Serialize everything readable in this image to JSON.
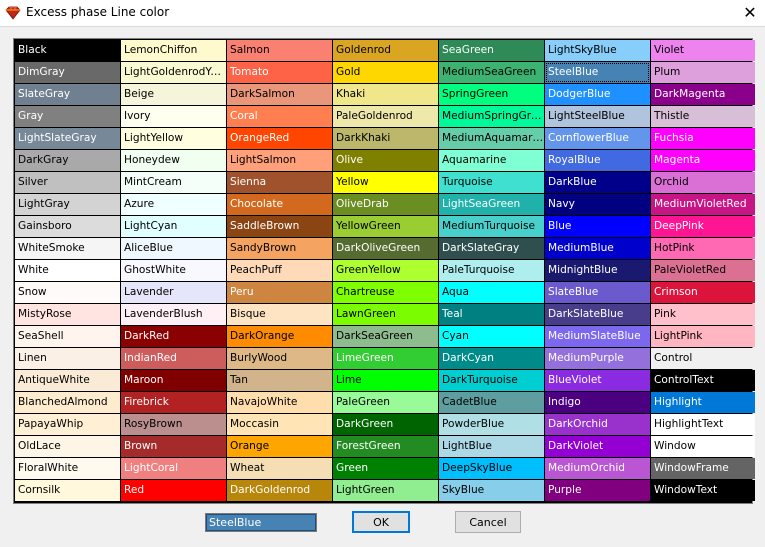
{
  "window": {
    "title": "Excess phase Line color",
    "close_glyph": "✕",
    "icon": "app-diamond-icon"
  },
  "palette": {
    "columns": [
      [
        {
          "name": "Black",
          "bg": "#000000",
          "fg": "#ffffff"
        },
        {
          "name": "DimGray",
          "bg": "#696969",
          "fg": "#ffffff"
        },
        {
          "name": "SlateGray",
          "bg": "#708090",
          "fg": "#ffffff"
        },
        {
          "name": "Gray",
          "bg": "#808080",
          "fg": "#ffffff"
        },
        {
          "name": "LightSlateGray",
          "bg": "#778899",
          "fg": "#ffffff"
        },
        {
          "name": "DarkGray",
          "bg": "#a9a9a9",
          "fg": "#000000"
        },
        {
          "name": "Silver",
          "bg": "#c0c0c0",
          "fg": "#000000"
        },
        {
          "name": "LightGray",
          "bg": "#d3d3d3",
          "fg": "#000000"
        },
        {
          "name": "Gainsboro",
          "bg": "#dcdcdc",
          "fg": "#000000"
        },
        {
          "name": "WhiteSmoke",
          "bg": "#f5f5f5",
          "fg": "#000000"
        },
        {
          "name": "White",
          "bg": "#ffffff",
          "fg": "#000000"
        },
        {
          "name": "Snow",
          "bg": "#fffafa",
          "fg": "#000000"
        },
        {
          "name": "MistyRose",
          "bg": "#ffe4e1",
          "fg": "#000000"
        },
        {
          "name": "SeaShell",
          "bg": "#fff5ee",
          "fg": "#000000"
        },
        {
          "name": "Linen",
          "bg": "#faf0e6",
          "fg": "#000000"
        },
        {
          "name": "AntiqueWhite",
          "bg": "#faebd7",
          "fg": "#000000"
        },
        {
          "name": "BlanchedAlmond",
          "bg": "#ffebcd",
          "fg": "#000000"
        },
        {
          "name": "PapayaWhip",
          "bg": "#ffefd5",
          "fg": "#000000"
        },
        {
          "name": "OldLace",
          "bg": "#fdf5e6",
          "fg": "#000000"
        },
        {
          "name": "FloralWhite",
          "bg": "#fffaf0",
          "fg": "#000000"
        },
        {
          "name": "Cornsilk",
          "bg": "#fff8dc",
          "fg": "#000000"
        }
      ],
      [
        {
          "name": "LemonChiffon",
          "bg": "#fffacd",
          "fg": "#000000"
        },
        {
          "name": "LightGoldenrodYellow",
          "bg": "#fafad2",
          "fg": "#000000"
        },
        {
          "name": "Beige",
          "bg": "#f5f5dc",
          "fg": "#000000"
        },
        {
          "name": "Ivory",
          "bg": "#fffff0",
          "fg": "#000000"
        },
        {
          "name": "LightYellow",
          "bg": "#ffffe0",
          "fg": "#000000"
        },
        {
          "name": "Honeydew",
          "bg": "#f0fff0",
          "fg": "#000000"
        },
        {
          "name": "MintCream",
          "bg": "#f5fffa",
          "fg": "#000000"
        },
        {
          "name": "Azure",
          "bg": "#f0ffff",
          "fg": "#000000"
        },
        {
          "name": "LightCyan",
          "bg": "#e0ffff",
          "fg": "#000000"
        },
        {
          "name": "AliceBlue",
          "bg": "#f0f8ff",
          "fg": "#000000"
        },
        {
          "name": "GhostWhite",
          "bg": "#f8f8ff",
          "fg": "#000000"
        },
        {
          "name": "Lavender",
          "bg": "#e6e6fa",
          "fg": "#000000"
        },
        {
          "name": "LavenderBlush",
          "bg": "#fff0f5",
          "fg": "#000000"
        },
        {
          "name": "DarkRed",
          "bg": "#8b0000",
          "fg": "#ffffff"
        },
        {
          "name": "IndianRed",
          "bg": "#cd5c5c",
          "fg": "#ffffff"
        },
        {
          "name": "Maroon",
          "bg": "#800000",
          "fg": "#ffffff"
        },
        {
          "name": "Firebrick",
          "bg": "#b22222",
          "fg": "#ffffff"
        },
        {
          "name": "RosyBrown",
          "bg": "#bc8f8f",
          "fg": "#000000"
        },
        {
          "name": "Brown",
          "bg": "#a52a2a",
          "fg": "#ffffff"
        },
        {
          "name": "LightCoral",
          "bg": "#f08080",
          "fg": "#ffffff"
        },
        {
          "name": "Red",
          "bg": "#ff0000",
          "fg": "#ffffff"
        }
      ],
      [
        {
          "name": "Salmon",
          "bg": "#fa8072",
          "fg": "#000000"
        },
        {
          "name": "Tomato",
          "bg": "#ff6347",
          "fg": "#ffffff"
        },
        {
          "name": "DarkSalmon",
          "bg": "#e9967a",
          "fg": "#000000"
        },
        {
          "name": "Coral",
          "bg": "#ff7f50",
          "fg": "#ffffff"
        },
        {
          "name": "OrangeRed",
          "bg": "#ff4500",
          "fg": "#ffffff"
        },
        {
          "name": "LightSalmon",
          "bg": "#ffa07a",
          "fg": "#000000"
        },
        {
          "name": "Sienna",
          "bg": "#a0522d",
          "fg": "#ffffff"
        },
        {
          "name": "Chocolate",
          "bg": "#d2691e",
          "fg": "#ffffff"
        },
        {
          "name": "SaddleBrown",
          "bg": "#8b4513",
          "fg": "#ffffff"
        },
        {
          "name": "SandyBrown",
          "bg": "#f4a460",
          "fg": "#000000"
        },
        {
          "name": "PeachPuff",
          "bg": "#ffdab9",
          "fg": "#000000"
        },
        {
          "name": "Peru",
          "bg": "#cd853f",
          "fg": "#ffffff"
        },
        {
          "name": "Bisque",
          "bg": "#ffe4c4",
          "fg": "#000000"
        },
        {
          "name": "DarkOrange",
          "bg": "#ff8c00",
          "fg": "#000000"
        },
        {
          "name": "BurlyWood",
          "bg": "#deb887",
          "fg": "#000000"
        },
        {
          "name": "Tan",
          "bg": "#d2b48c",
          "fg": "#000000"
        },
        {
          "name": "NavajoWhite",
          "bg": "#ffdead",
          "fg": "#000000"
        },
        {
          "name": "Moccasin",
          "bg": "#ffe4b5",
          "fg": "#000000"
        },
        {
          "name": "Orange",
          "bg": "#ffa500",
          "fg": "#000000"
        },
        {
          "name": "Wheat",
          "bg": "#f5deb3",
          "fg": "#000000"
        },
        {
          "name": "DarkGoldenrod",
          "bg": "#b8860b",
          "fg": "#ffffff"
        }
      ],
      [
        {
          "name": "Goldenrod",
          "bg": "#daa520",
          "fg": "#000000"
        },
        {
          "name": "Gold",
          "bg": "#ffd700",
          "fg": "#000000"
        },
        {
          "name": "Khaki",
          "bg": "#f0e68c",
          "fg": "#000000"
        },
        {
          "name": "PaleGoldenrod",
          "bg": "#eee8aa",
          "fg": "#000000"
        },
        {
          "name": "DarkKhaki",
          "bg": "#bdb76b",
          "fg": "#000000"
        },
        {
          "name": "Olive",
          "bg": "#808000",
          "fg": "#ffffff"
        },
        {
          "name": "Yellow",
          "bg": "#ffff00",
          "fg": "#000000"
        },
        {
          "name": "OliveDrab",
          "bg": "#6b8e23",
          "fg": "#ffffff"
        },
        {
          "name": "YellowGreen",
          "bg": "#9acd32",
          "fg": "#000000"
        },
        {
          "name": "DarkOliveGreen",
          "bg": "#556b2f",
          "fg": "#ffffff"
        },
        {
          "name": "GreenYellow",
          "bg": "#adff2f",
          "fg": "#000000"
        },
        {
          "name": "Chartreuse",
          "bg": "#7fff00",
          "fg": "#000000"
        },
        {
          "name": "LawnGreen",
          "bg": "#7cfc00",
          "fg": "#000000"
        },
        {
          "name": "DarkSeaGreen",
          "bg": "#8fbc8f",
          "fg": "#000000"
        },
        {
          "name": "LimeGreen",
          "bg": "#32cd32",
          "fg": "#ffffff"
        },
        {
          "name": "Lime",
          "bg": "#00ff00",
          "fg": "#000000"
        },
        {
          "name": "PaleGreen",
          "bg": "#98fb98",
          "fg": "#000000"
        },
        {
          "name": "DarkGreen",
          "bg": "#006400",
          "fg": "#ffffff"
        },
        {
          "name": "ForestGreen",
          "bg": "#228b22",
          "fg": "#ffffff"
        },
        {
          "name": "Green",
          "bg": "#008000",
          "fg": "#ffffff"
        },
        {
          "name": "LightGreen",
          "bg": "#90ee90",
          "fg": "#000000"
        }
      ],
      [
        {
          "name": "SeaGreen",
          "bg": "#2e8b57",
          "fg": "#ffffff"
        },
        {
          "name": "MediumSeaGreen",
          "bg": "#3cb371",
          "fg": "#000000"
        },
        {
          "name": "SpringGreen",
          "bg": "#00ff7f",
          "fg": "#000000"
        },
        {
          "name": "MediumSpringGreen",
          "bg": "#00fa9a",
          "fg": "#000000"
        },
        {
          "name": "MediumAquamarine",
          "bg": "#66cdaa",
          "fg": "#000000"
        },
        {
          "name": "Aquamarine",
          "bg": "#7fffd4",
          "fg": "#000000"
        },
        {
          "name": "Turquoise",
          "bg": "#40e0d0",
          "fg": "#000000"
        },
        {
          "name": "LightSeaGreen",
          "bg": "#20b2aa",
          "fg": "#ffffff"
        },
        {
          "name": "MediumTurquoise",
          "bg": "#48d1cc",
          "fg": "#000000"
        },
        {
          "name": "DarkSlateGray",
          "bg": "#2f4f4f",
          "fg": "#ffffff"
        },
        {
          "name": "PaleTurquoise",
          "bg": "#afeeee",
          "fg": "#000000"
        },
        {
          "name": "Aqua",
          "bg": "#00ffff",
          "fg": "#000000"
        },
        {
          "name": "Teal",
          "bg": "#008080",
          "fg": "#ffffff"
        },
        {
          "name": "Cyan",
          "bg": "#00ffff",
          "fg": "#000000"
        },
        {
          "name": "DarkCyan",
          "bg": "#008b8b",
          "fg": "#ffffff"
        },
        {
          "name": "DarkTurquoise",
          "bg": "#00ced1",
          "fg": "#000000"
        },
        {
          "name": "CadetBlue",
          "bg": "#5f9ea0",
          "fg": "#000000"
        },
        {
          "name": "PowderBlue",
          "bg": "#b0e0e6",
          "fg": "#000000"
        },
        {
          "name": "LightBlue",
          "bg": "#add8e6",
          "fg": "#000000"
        },
        {
          "name": "DeepSkyBlue",
          "bg": "#00bfff",
          "fg": "#000000"
        },
        {
          "name": "SkyBlue",
          "bg": "#87ceeb",
          "fg": "#000000"
        }
      ],
      [
        {
          "name": "LightSkyBlue",
          "bg": "#87cefa",
          "fg": "#000000"
        },
        {
          "name": "SteelBlue",
          "bg": "#4682b4",
          "fg": "#ffffff"
        },
        {
          "name": "DodgerBlue",
          "bg": "#1e90ff",
          "fg": "#ffffff"
        },
        {
          "name": "LightSteelBlue",
          "bg": "#b0c4de",
          "fg": "#000000"
        },
        {
          "name": "CornflowerBlue",
          "bg": "#6495ed",
          "fg": "#ffffff"
        },
        {
          "name": "RoyalBlue",
          "bg": "#4169e1",
          "fg": "#ffffff"
        },
        {
          "name": "DarkBlue",
          "bg": "#00008b",
          "fg": "#ffffff"
        },
        {
          "name": "Navy",
          "bg": "#000080",
          "fg": "#ffffff"
        },
        {
          "name": "Blue",
          "bg": "#0000ff",
          "fg": "#ffffff"
        },
        {
          "name": "MediumBlue",
          "bg": "#0000cd",
          "fg": "#ffffff"
        },
        {
          "name": "MidnightBlue",
          "bg": "#191970",
          "fg": "#ffffff"
        },
        {
          "name": "SlateBlue",
          "bg": "#6a5acd",
          "fg": "#ffffff"
        },
        {
          "name": "DarkSlateBlue",
          "bg": "#483d8b",
          "fg": "#ffffff"
        },
        {
          "name": "MediumSlateBlue",
          "bg": "#7b68ee",
          "fg": "#ffffff"
        },
        {
          "name": "MediumPurple",
          "bg": "#9370db",
          "fg": "#ffffff"
        },
        {
          "name": "BlueViolet",
          "bg": "#8a2be2",
          "fg": "#ffffff"
        },
        {
          "name": "Indigo",
          "bg": "#4b0082",
          "fg": "#ffffff"
        },
        {
          "name": "DarkOrchid",
          "bg": "#9932cc",
          "fg": "#ffffff"
        },
        {
          "name": "DarkViolet",
          "bg": "#9400d3",
          "fg": "#ffffff"
        },
        {
          "name": "MediumOrchid",
          "bg": "#ba55d3",
          "fg": "#ffffff"
        },
        {
          "name": "Purple",
          "bg": "#800080",
          "fg": "#ffffff"
        }
      ],
      [
        {
          "name": "Violet",
          "bg": "#ee82ee",
          "fg": "#000000"
        },
        {
          "name": "Plum",
          "bg": "#dda0dd",
          "fg": "#000000"
        },
        {
          "name": "DarkMagenta",
          "bg": "#8b008b",
          "fg": "#ffffff"
        },
        {
          "name": "Thistle",
          "bg": "#d8bfd8",
          "fg": "#000000"
        },
        {
          "name": "Fuchsia",
          "bg": "#ff00ff",
          "fg": "#ffffff"
        },
        {
          "name": "Magenta",
          "bg": "#ff00ff",
          "fg": "#ffffff"
        },
        {
          "name": "Orchid",
          "bg": "#da70d6",
          "fg": "#000000"
        },
        {
          "name": "MediumVioletRed",
          "bg": "#c71585",
          "fg": "#ffffff"
        },
        {
          "name": "DeepPink",
          "bg": "#ff1493",
          "fg": "#ffffff"
        },
        {
          "name": "HotPink",
          "bg": "#ff69b4",
          "fg": "#000000"
        },
        {
          "name": "PaleVioletRed",
          "bg": "#db7093",
          "fg": "#000000"
        },
        {
          "name": "Crimson",
          "bg": "#dc143c",
          "fg": "#ffffff"
        },
        {
          "name": "Pink",
          "bg": "#ffc0cb",
          "fg": "#000000"
        },
        {
          "name": "LightPink",
          "bg": "#ffb6c1",
          "fg": "#000000"
        },
        {
          "name": "Control",
          "bg": "#f0f0f0",
          "fg": "#000000"
        },
        {
          "name": "ControlText",
          "bg": "#000000",
          "fg": "#ffffff"
        },
        {
          "name": "Highlight",
          "bg": "#0078d7",
          "fg": "#ffffff"
        },
        {
          "name": "HighlightText",
          "bg": "#ffffff",
          "fg": "#000000"
        },
        {
          "name": "Window",
          "bg": "#ffffff",
          "fg": "#000000"
        },
        {
          "name": "WindowFrame",
          "bg": "#646464",
          "fg": "#ffffff"
        },
        {
          "name": "WindowText",
          "bg": "#000000",
          "fg": "#ffffff"
        }
      ]
    ],
    "selected_name": "SteelBlue"
  },
  "footer": {
    "selected_label": "SteelBlue",
    "selected_bg": "#4682b4",
    "ok_label": "OK",
    "cancel_label": "Cancel"
  }
}
